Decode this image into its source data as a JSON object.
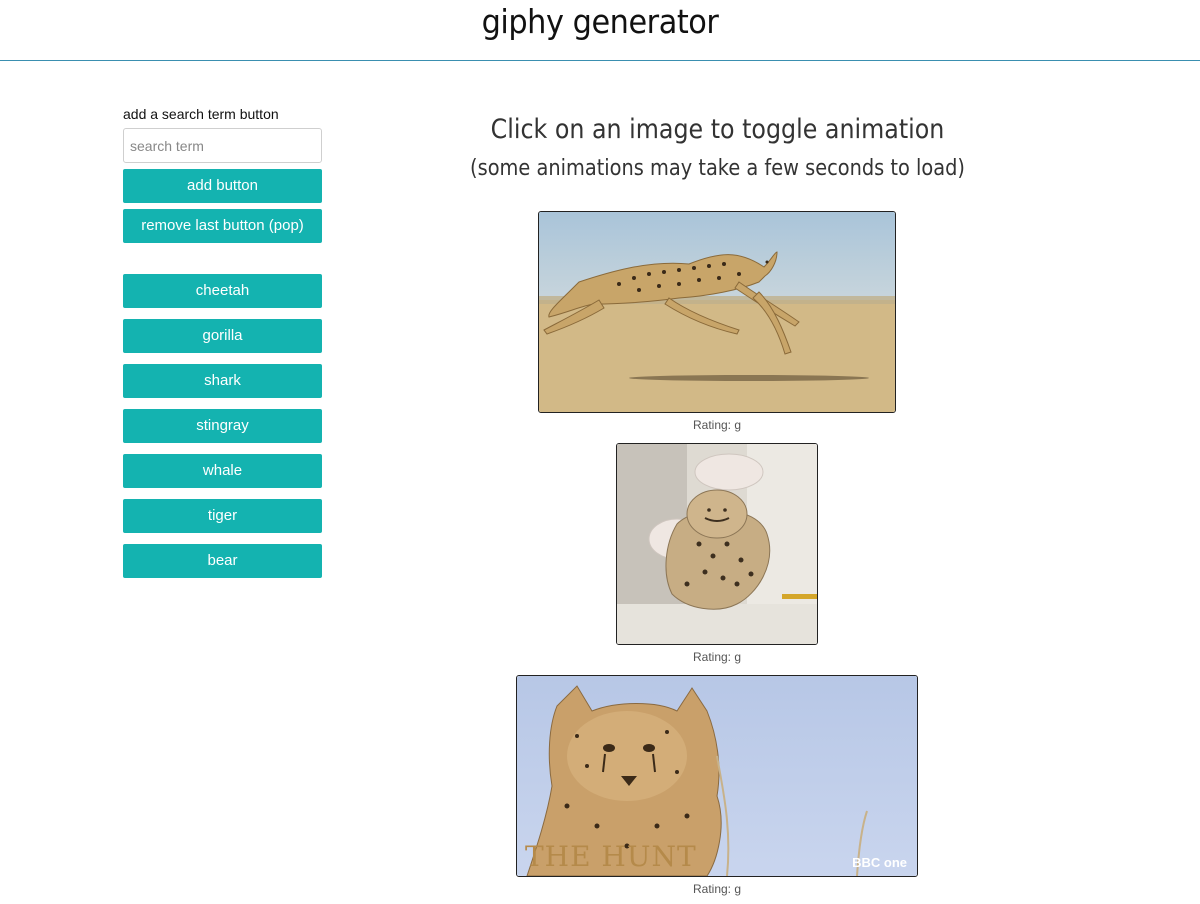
{
  "header": {
    "title": "giphy generator"
  },
  "sidebar": {
    "label": "add a search term button",
    "search_placeholder": "search term",
    "add_button": "add button",
    "pop_button": "remove last button (pop)",
    "topics": [
      "cheetah",
      "gorilla",
      "shark",
      "stingray",
      "whale",
      "tiger",
      "bear"
    ]
  },
  "main": {
    "heading": "Click on an image to toggle animation",
    "subheading": "(some animations may take a few seconds to load)",
    "gifs": [
      {
        "rating": "Rating: g",
        "subject": "cheetah running across desert"
      },
      {
        "rating": "Rating: g",
        "subject": "cheetah cub being petted"
      },
      {
        "rating": "Rating: g",
        "subject": "cheetah cub close-up",
        "overlay_text": "THE HUNT",
        "channel_logo": "BBC one"
      }
    ]
  },
  "colors": {
    "accent": "#14b3b0",
    "header_rule": "#3a8fb0"
  }
}
